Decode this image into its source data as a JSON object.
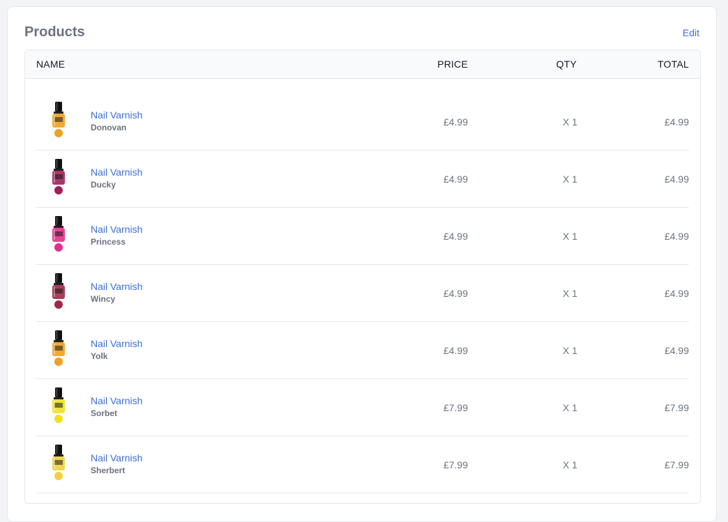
{
  "card": {
    "title": "Products",
    "edit_label": "Edit"
  },
  "table": {
    "headers": {
      "name": "NAME",
      "price": "PRICE",
      "qty": "QTY",
      "total": "TOTAL"
    },
    "rows": [
      {
        "name": "Nail Varnish",
        "variant": "Donovan",
        "price": "£4.99",
        "qty": "X 1",
        "total": "£4.99",
        "color": "#f0a020",
        "icon": "nail-varnish-bottle-icon"
      },
      {
        "name": "Nail Varnish",
        "variant": "Ducky",
        "price": "£4.99",
        "qty": "X 1",
        "total": "£4.99",
        "color": "#a0205a",
        "icon": "nail-varnish-bottle-icon"
      },
      {
        "name": "Nail Varnish",
        "variant": "Princess",
        "price": "£4.99",
        "qty": "X 1",
        "total": "£4.99",
        "color": "#e0308a",
        "icon": "nail-varnish-bottle-icon"
      },
      {
        "name": "Nail Varnish",
        "variant": "Wincy",
        "price": "£4.99",
        "qty": "X 1",
        "total": "£4.99",
        "color": "#a02848",
        "icon": "nail-varnish-bottle-icon"
      },
      {
        "name": "Nail Varnish",
        "variant": "Yolk",
        "price": "£4.99",
        "qty": "X 1",
        "total": "£4.99",
        "color": "#f0a020",
        "icon": "nail-varnish-bottle-icon"
      },
      {
        "name": "Nail Varnish",
        "variant": "Sorbet",
        "price": "£7.99",
        "qty": "X 1",
        "total": "£7.99",
        "color": "#f0e020",
        "icon": "nail-varnish-bottle-icon"
      },
      {
        "name": "Nail Varnish",
        "variant": "Sherbert",
        "price": "£7.99",
        "qty": "X 1",
        "total": "£7.99",
        "color": "#f0d040",
        "icon": "nail-varnish-bottle-icon"
      }
    ]
  },
  "colors": {
    "link": "#3b6fd8",
    "muted_text": "#6b7280",
    "border": "#e5e7eb",
    "header_bg": "#f9fafb"
  }
}
